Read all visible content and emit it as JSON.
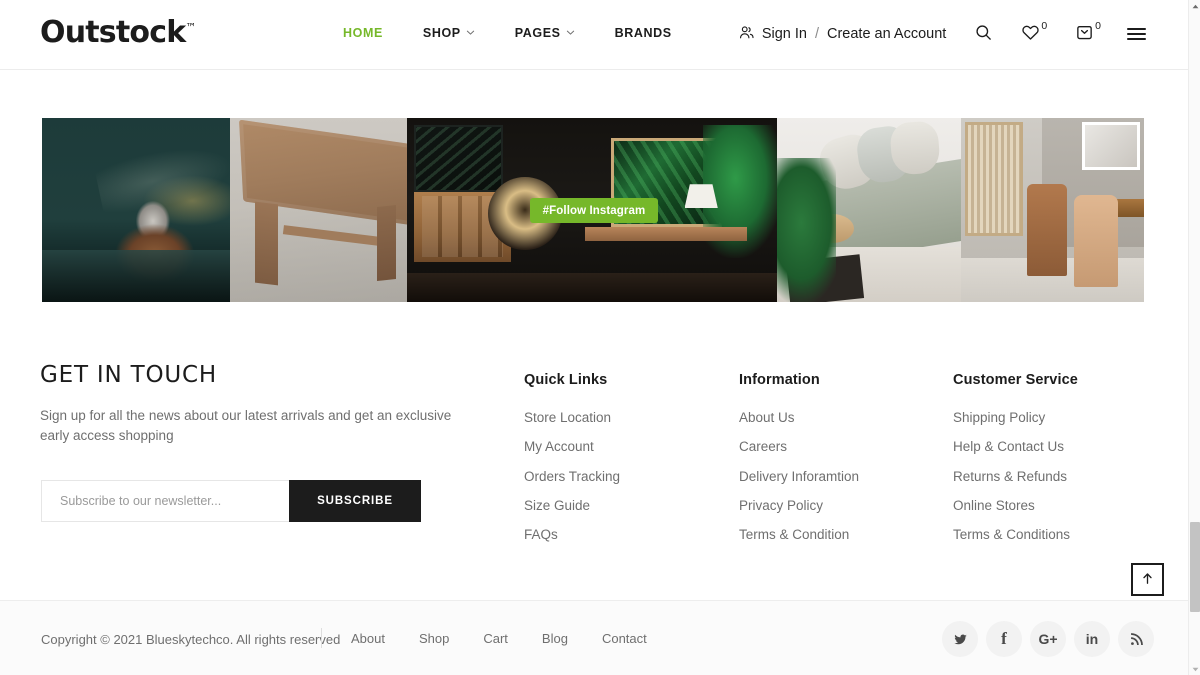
{
  "brand": {
    "name": "Outstock",
    "tm": "™"
  },
  "header": {
    "nav": [
      {
        "label": "HOME",
        "active": true,
        "caret": false,
        "icon": ""
      },
      {
        "label": "SHOP",
        "active": false,
        "caret": true,
        "icon": "chevron-down-icon"
      },
      {
        "label": "PAGES",
        "active": false,
        "caret": true,
        "icon": "chevron-down-icon"
      },
      {
        "label": "BRANDS",
        "active": false,
        "caret": false,
        "icon": ""
      }
    ],
    "account": {
      "icon": "user-icon",
      "sign_in": "Sign In",
      "separator": "/",
      "create": "Create an Account"
    },
    "search_icon": "search-icon",
    "wishlist": {
      "icon": "heart-icon",
      "count": "0"
    },
    "cart": {
      "icon": "bag-icon",
      "count": "0"
    },
    "menu_icon": "hamburger-icon"
  },
  "instagram": {
    "badge": "#Follow Instagram",
    "photos": [
      {
        "alt": "copper ice bucket on dark teal bar cart"
      },
      {
        "alt": "light wood side table on concrete floor"
      },
      {
        "alt": "dark living room with rattan chair and tropical leaf art"
      },
      {
        "alt": "grey sofa with cushions, round side table and plant"
      },
      {
        "alt": "dining chairs with cane cabinet and wall art"
      }
    ]
  },
  "footer": {
    "get_in_touch": {
      "title": "GET IN TOUCH",
      "text": "Sign up for all the news about our latest arrivals and get an exclusive early access shopping",
      "input_placeholder": "Subscribe to our newsletter...",
      "input_value": "",
      "button": "SUBSCRIBE"
    },
    "columns": [
      {
        "title": "Quick Links",
        "links": [
          "Store Location",
          "My Account",
          "Orders Tracking",
          "Size Guide",
          "FAQs"
        ]
      },
      {
        "title": "Information",
        "links": [
          "About Us",
          "Careers",
          "Delivery Inforamtion",
          "Privacy Policy",
          "Terms & Condition"
        ]
      },
      {
        "title": "Customer Service",
        "links": [
          "Shipping Policy",
          "Help & Contact Us",
          "Returns & Refunds",
          "Online Stores",
          "Terms & Conditions"
        ]
      }
    ]
  },
  "bottom": {
    "copyright": "Copyright © 2021 Blueskytechco. All rights reserved",
    "links": [
      "About",
      "Shop",
      "Cart",
      "Blog",
      "Contact"
    ],
    "socials": [
      {
        "name": "twitter-icon",
        "glyph": ""
      },
      {
        "name": "facebook-icon",
        "glyph": "f"
      },
      {
        "name": "google-plus-icon",
        "glyph": "G+"
      },
      {
        "name": "linkedin-icon",
        "glyph": "in"
      },
      {
        "name": "rss-icon",
        "glyph": ""
      }
    ]
  },
  "back_to_top": {
    "icon": "arrow-up-icon"
  },
  "colors": {
    "accent_green": "#76b82a",
    "dark": "#1c1c1c",
    "muted": "#6f6f6f",
    "bottom_bg": "#fbfbfb"
  }
}
